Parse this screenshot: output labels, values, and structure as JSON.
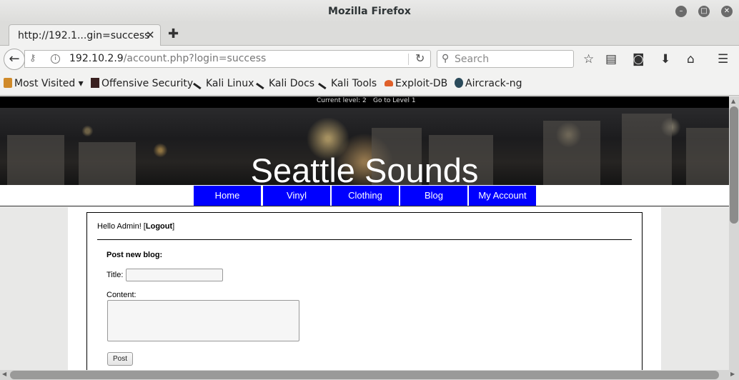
{
  "window": {
    "title": "Mozilla Firefox"
  },
  "tab": {
    "title": "http://192.1...gin=success",
    "close_glyph": "✕",
    "new_glyph": "✚"
  },
  "nav": {
    "url_host": "192.10.2.9",
    "url_path": "/account.php?login=success",
    "search_placeholder": "Search",
    "icons": [
      "back-icon",
      "key-icon",
      "info-icon",
      "reload-icon",
      "search-icon",
      "bookmark-star-icon",
      "reader-list-icon",
      "pocket-icon",
      "download-icon",
      "home-icon",
      "hamburger-menu-icon"
    ]
  },
  "bookmarks": [
    {
      "label": "Most Visited ▾",
      "icon": "folder-icon"
    },
    {
      "label": "Offensive Security",
      "icon": "offsec-icon"
    },
    {
      "label": "Kali Linux",
      "icon": "kali-dragon-icon"
    },
    {
      "label": "Kali Docs",
      "icon": "kali-dragon-icon"
    },
    {
      "label": "Kali Tools",
      "icon": "kali-dragon-icon"
    },
    {
      "label": "Exploit-DB",
      "icon": "exploit-db-icon"
    },
    {
      "label": "Aircrack-ng",
      "icon": "aircrack-icon"
    }
  ],
  "page": {
    "level_current": "Current level:  2",
    "level_goto": "Go to Level 1",
    "site_title": "Seattle Sounds",
    "menu": [
      "Home",
      "Vinyl",
      "Clothing",
      "Blog",
      "My Account"
    ],
    "greeting_prefix": "Hello Admin! [",
    "logout_label": "Logout",
    "greeting_suffix": "]",
    "form_title": "Post new blog:",
    "title_label": "Title:",
    "content_label": "Content:",
    "post_button": "Post"
  },
  "colors": {
    "menu_blue": "#0000ff",
    "level_bar": "#000000"
  }
}
